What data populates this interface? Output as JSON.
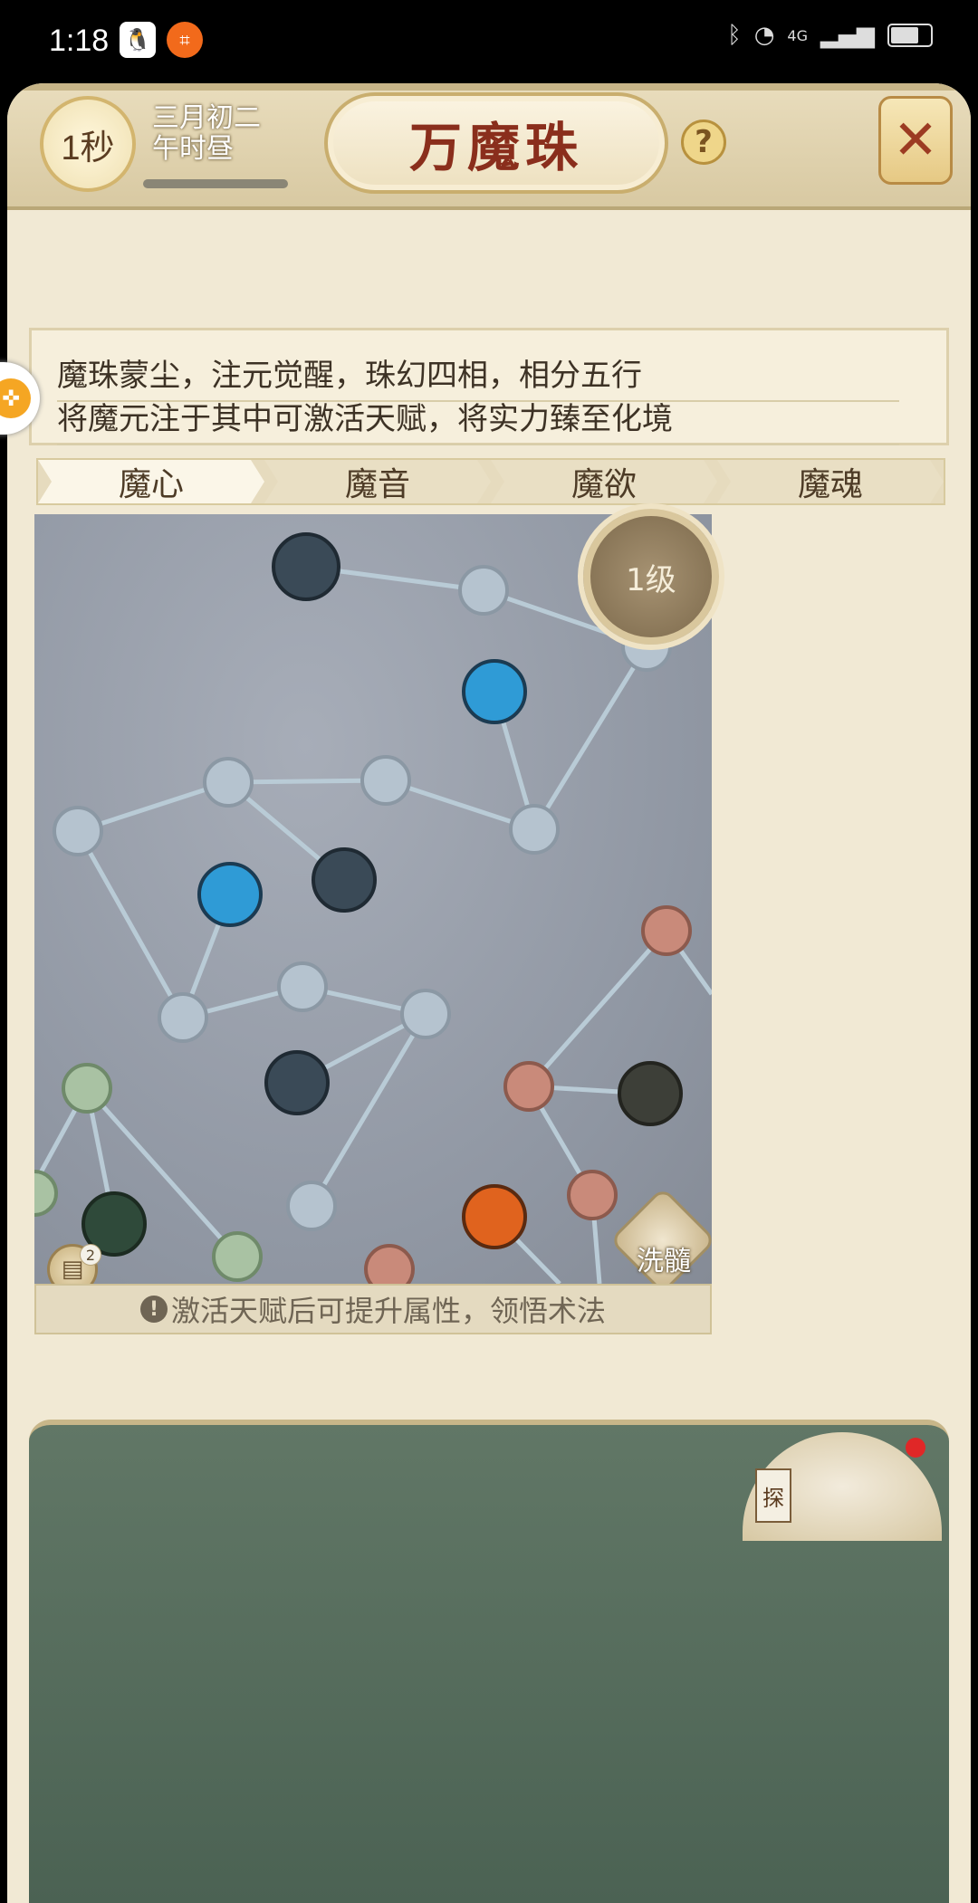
{
  "status_bar": {
    "time": "1:18",
    "app_icons": [
      "qq-icon",
      "crop-app-icon"
    ],
    "right_icons": [
      "bluetooth-icon",
      "wifi-icon",
      "signal-icon",
      "battery-icon"
    ],
    "network_label": "4G"
  },
  "header": {
    "timer": "1秒",
    "date_line1": "三月初二",
    "date_line2": "午时昼",
    "title": "万魔珠",
    "help": "?",
    "close": "✕"
  },
  "description": {
    "line1": "魔珠蒙尘，注元觉醒，珠幻四相，相分五行",
    "line2": "将魔元注于其中可激活天赋，将实力臻至化境"
  },
  "tabs": [
    {
      "label": "魔心",
      "active": true
    },
    {
      "label": "魔音",
      "active": false
    },
    {
      "label": "魔欲",
      "active": false
    },
    {
      "label": "魔魂",
      "active": false
    }
  ],
  "skill_map": {
    "level": "1级",
    "wash_label": "洗髓",
    "chat_badge": "2",
    "colors": {
      "silver_node": "#b5c3cf",
      "blue_active": "#2f9bd6",
      "dark_node": "#3a4a57",
      "red_node": "#c98a7a",
      "green_node": "#a9c2a3",
      "fire_node": "#e0631e",
      "line": "#b9cbd6"
    }
  },
  "hint": {
    "icon": "!",
    "text": "激活天赋后可提升属性，领悟术法"
  },
  "bottom": {
    "tag": "探"
  }
}
